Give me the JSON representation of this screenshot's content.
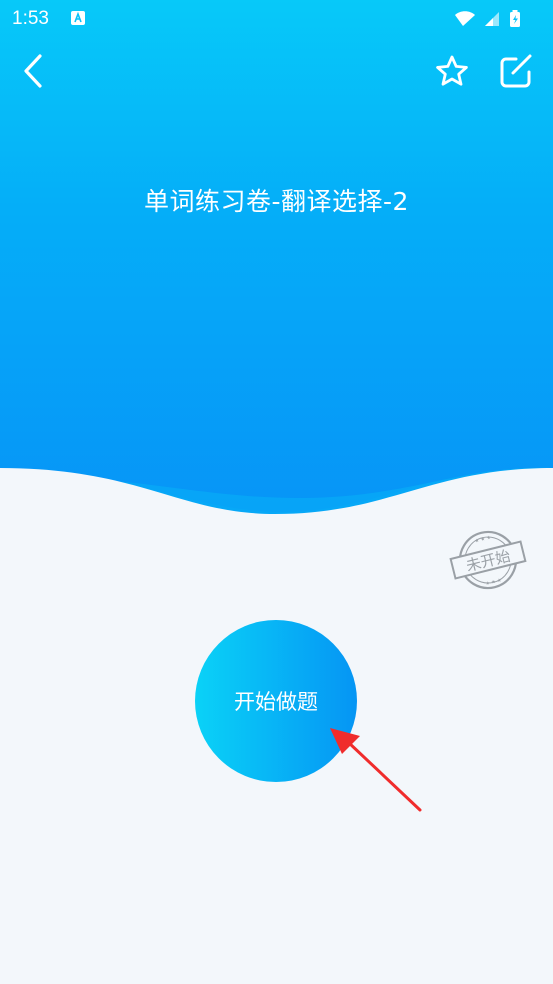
{
  "status_bar": {
    "time": "1:53",
    "app_icon": "app-notification-icon",
    "wifi_icon": "wifi-icon",
    "signal_icon": "cell-signal-icon",
    "battery_icon": "battery-charging-icon"
  },
  "nav": {
    "back_icon": "chevron-left-icon",
    "favorite_icon": "star-icon",
    "edit_icon": "edit-icon"
  },
  "header": {
    "title": "单词练习卷-翻译选择-2"
  },
  "status_stamp": {
    "label": "未开始"
  },
  "main": {
    "start_button_label": "开始做题"
  },
  "colors": {
    "header_gradient_top": "#07c9f9",
    "header_gradient_bottom": "#0794f7",
    "page_background": "#f3f7fb",
    "button_gradient_left": "#0ad2f7",
    "button_gradient_right": "#0595f4",
    "stamp_gray": "#9aa0a6",
    "annotation_arrow": "#f02c2c"
  }
}
